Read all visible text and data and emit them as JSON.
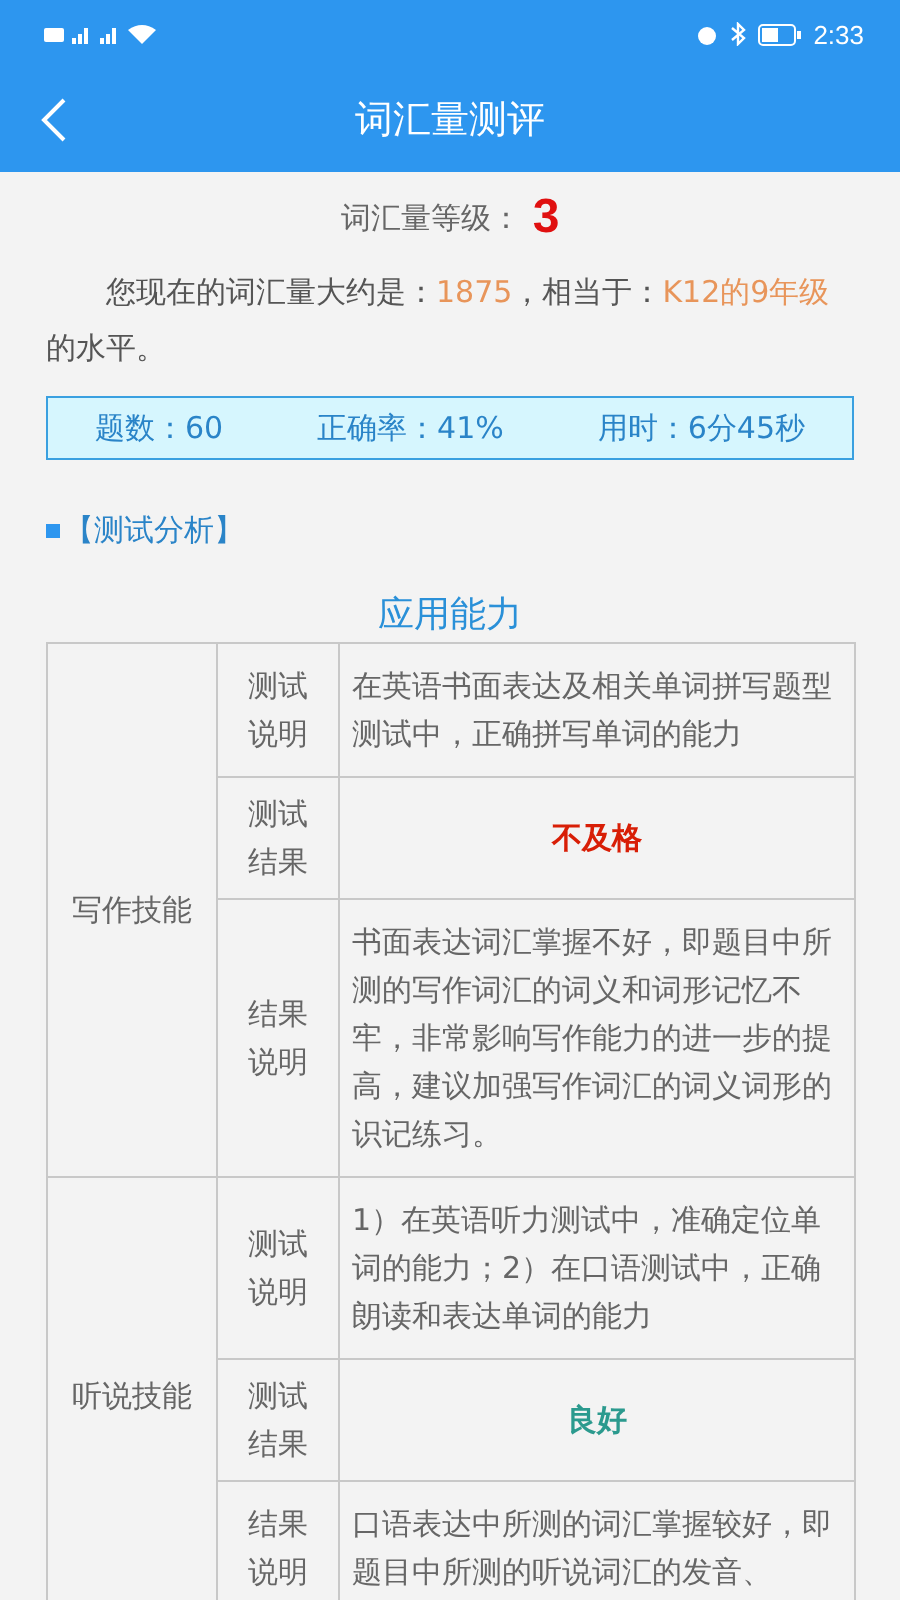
{
  "status_bar": {
    "time": "2:33"
  },
  "header": {
    "title": "词汇量测评"
  },
  "level": {
    "label": "词汇量等级：",
    "value": "3"
  },
  "summary": {
    "parts": [
      {
        "text": "您现在的词汇量大约是：",
        "highlight": false
      },
      {
        "text": "1875",
        "highlight": true
      },
      {
        "text": "，相当于：",
        "highlight": false
      },
      {
        "text": "K12的9年级",
        "highlight": true
      },
      {
        "text": "的水平。",
        "highlight": false
      }
    ]
  },
  "stats": [
    "题数：60",
    "正确率：41%",
    "用时：6分45秒"
  ],
  "section_title": "【测试分析】",
  "table": {
    "title": "应用能力",
    "groups": [
      {
        "skill": "写作技能",
        "rows": [
          {
            "kind": "text",
            "label": "测试说明",
            "text": "在英语书面表达及相关单词拼写题型测试中，正确拼写单词的能力"
          },
          {
            "kind": "result",
            "label": "测试结果",
            "text": "不及格",
            "color": "#d81e06"
          },
          {
            "kind": "text",
            "label": "结果说明",
            "text": "书面表达词汇掌握不好，即题目中所测的写作词汇的词义和词形记忆不牢，非常影响写作能力的进一步的提高，建议加强写作词汇的词义词形的识记练习。"
          }
        ]
      },
      {
        "skill": "听说技能",
        "rows": [
          {
            "kind": "text",
            "label": "测试说明",
            "text": "1）在英语听力测试中，准确定位单词的能力；2）在口语测试中，正确朗读和表达单词的能力"
          },
          {
            "kind": "result",
            "label": "测试结果",
            "text": "良好",
            "color": "#2b9a8e"
          },
          {
            "kind": "text",
            "label": "结果说明",
            "text": "口语表达中所测的词汇掌握较好，即题目中所测的听说词汇的发音、"
          }
        ]
      }
    ]
  }
}
